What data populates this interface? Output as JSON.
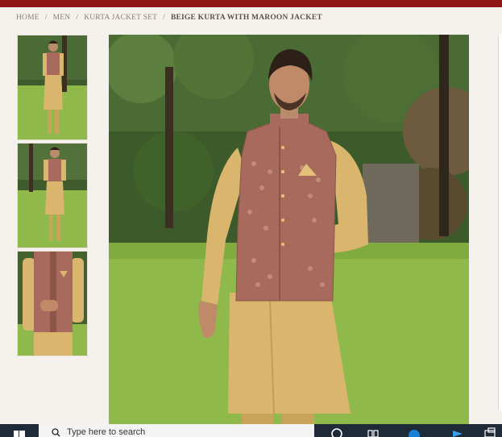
{
  "breadcrumb": {
    "items": [
      "HOME",
      "MEN",
      "KURTA JACKET SET"
    ],
    "current": "BEIGE KURTA WITH MAROON JACKET",
    "separator": "/"
  },
  "colors": {
    "brand_bar": "#8e1616",
    "page_bg": "#f5f1ec",
    "kurta": "#d9b56e",
    "jacket": "#a76a5c",
    "grass": "#8fb94a"
  },
  "gallery": {
    "thumbnails": [
      "thumbnail-full-front",
      "thumbnail-full-side",
      "thumbnail-closeup"
    ],
    "main_image": "beige-kurta-maroon-jacket-photo"
  },
  "taskbar": {
    "search_placeholder": "Type here to search",
    "icons": [
      "windows-start-icon",
      "search-icon",
      "cortana-icon",
      "task-view-icon",
      "edge-icon",
      "store-icon",
      "files-icon"
    ]
  }
}
